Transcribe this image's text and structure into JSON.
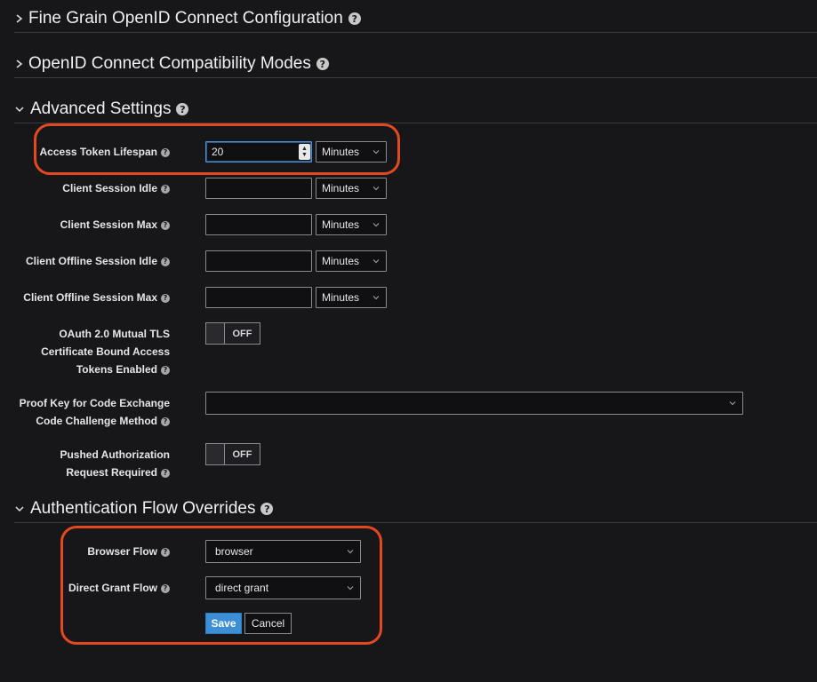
{
  "sections": {
    "fine_grain": "Fine Grain OpenID Connect Configuration",
    "compat_modes": "OpenID Connect Compatibility Modes",
    "advanced": "Advanced Settings",
    "auth_flow": "Authentication Flow Overrides"
  },
  "fields": {
    "access_token_lifespan": {
      "label": "Access Token Lifespan",
      "value": "20",
      "unit": "Minutes"
    },
    "client_session_idle": {
      "label": "Client Session Idle",
      "value": "",
      "unit": "Minutes"
    },
    "client_session_max": {
      "label": "Client Session Max",
      "value": "",
      "unit": "Minutes"
    },
    "client_offline_session_idle": {
      "label": "Client Offline Session Idle",
      "value": "",
      "unit": "Minutes"
    },
    "client_offline_session_max": {
      "label": "Client Offline Session Max",
      "value": "",
      "unit": "Minutes"
    },
    "mtls": {
      "label_1": "OAuth 2.0 Mutual TLS",
      "label_2": "Certificate Bound Access",
      "label_3": "Tokens Enabled",
      "state": "OFF"
    },
    "pkce": {
      "label_1": "Proof Key for Code Exchange",
      "label_2": "Code Challenge Method",
      "value": ""
    },
    "par": {
      "label_1": "Pushed Authorization",
      "label_2": "Request Required",
      "state": "OFF"
    },
    "browser_flow": {
      "label": "Browser Flow",
      "value": "browser"
    },
    "direct_grant_flow": {
      "label": "Direct Grant Flow",
      "value": "direct grant"
    }
  },
  "buttons": {
    "save": "Save",
    "cancel": "Cancel"
  },
  "colors": {
    "accent": "#3c8fd4",
    "highlight": "#e4481f",
    "background": "#17171a"
  }
}
